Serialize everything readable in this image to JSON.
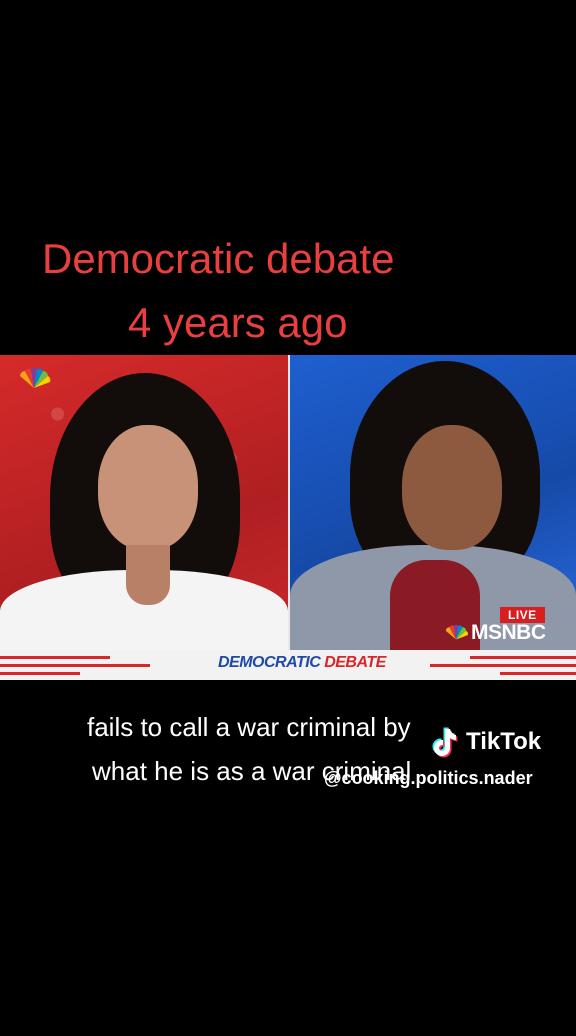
{
  "caption": {
    "line1": "Democratic debate",
    "line2": "4 years ago",
    "color": "#e8403f"
  },
  "video": {
    "left_panel_color": "#c8292c",
    "right_panel_color": "#1e5fd0",
    "network_logo_icon": "nbc-peacock-icon",
    "live_label": "LIVE",
    "network_label": "MSNBC",
    "banner": {
      "part1": "DEMOCRATIC ",
      "part2": "DEBATE"
    }
  },
  "subtitles": {
    "line1": "fails to call a war criminal by",
    "line2": "what he is as a war criminal"
  },
  "watermark": {
    "brand": "TikTok",
    "handle": "@cooking.politics.nader",
    "icon": "tiktok-note-icon"
  }
}
